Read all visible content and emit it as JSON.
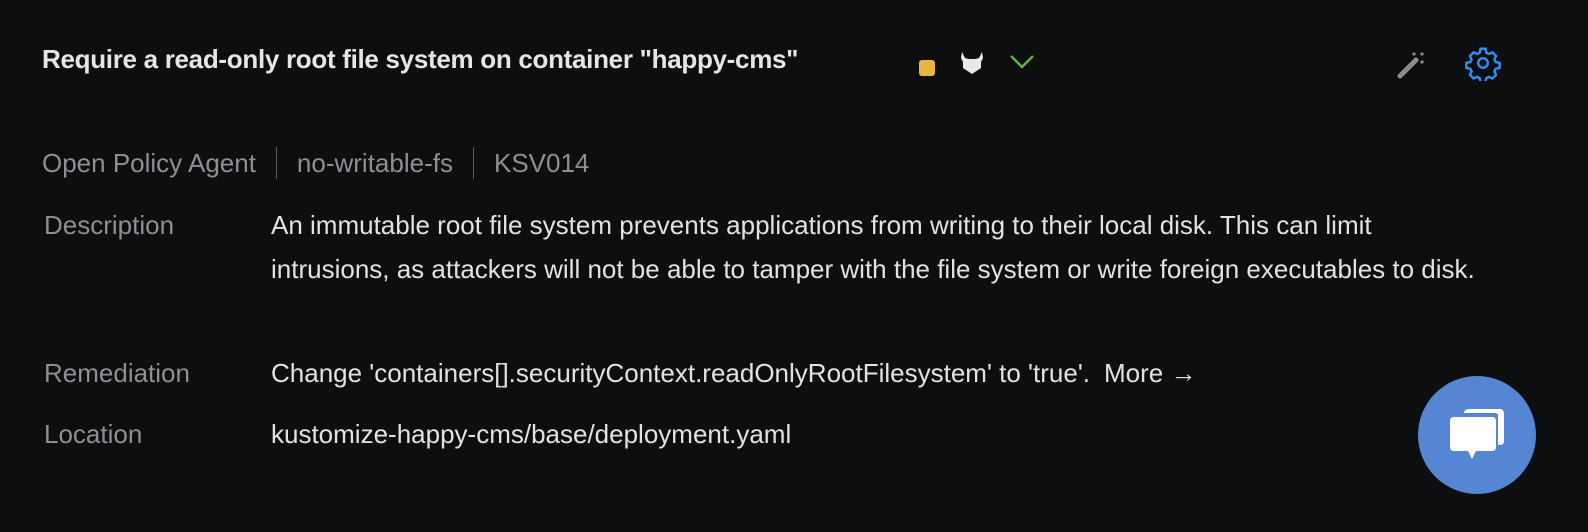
{
  "header": {
    "title": "Require a read-only root file system on container \"happy-cms\"",
    "severity_color": "#e8b63f",
    "status_icons": [
      "severity-medium-square",
      "opa-viking-helmet-icon",
      "check-icon"
    ],
    "actions": [
      "magic-wand-icon",
      "gear-icon"
    ],
    "accent_color": "#2f8ff5",
    "check_color": "#5ab53f"
  },
  "meta": {
    "engine": "Open Policy Agent",
    "rule_name": "no-writable-fs",
    "rule_id": "KSV014"
  },
  "details": {
    "description_label": "Description",
    "description": "An immutable root file system prevents applications from writing to their local disk. This can limit intrusions, as attackers will not be able to tamper with the file system or write foreign executables to disk.",
    "remediation_label": "Remediation",
    "remediation": "Change 'containers[].securityContext.readOnlyRootFilesystem' to 'true'.",
    "more_label": "More →",
    "location_label": "Location",
    "location": "kustomize-happy-cms/base/deployment.yaml"
  },
  "chat": {
    "icon": "chat-bubbles-icon",
    "color": "#5585d3"
  }
}
